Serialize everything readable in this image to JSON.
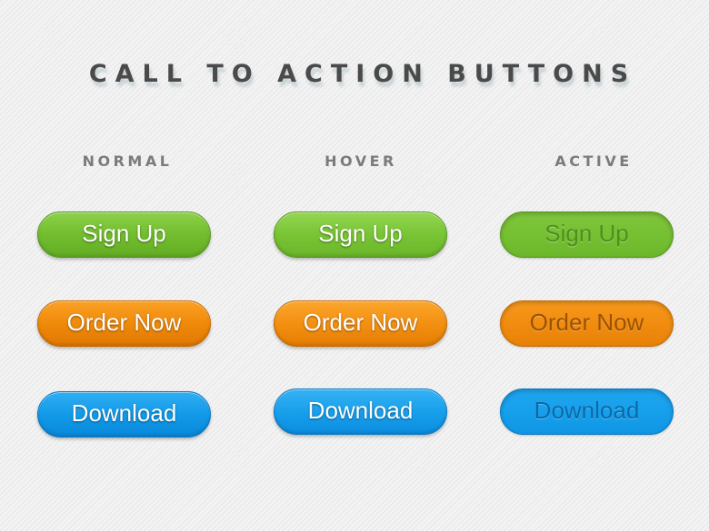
{
  "title": "CALL TO ACTION BUTTONS",
  "columns": [
    {
      "label": "NORMAL",
      "state": "normal"
    },
    {
      "label": "HOVER",
      "state": "hover"
    },
    {
      "label": "ACTIVE",
      "state": "active"
    }
  ],
  "rows": [
    {
      "label": "Sign Up",
      "color_name": "green",
      "color": "#74bf30"
    },
    {
      "label": "Order Now",
      "color_name": "orange",
      "color": "#f08a0a"
    },
    {
      "label": "Download",
      "color_name": "blue",
      "color": "#129ae8"
    }
  ],
  "buttons": {
    "signup_normal": "Sign Up",
    "signup_hover": "Sign Up",
    "signup_active": "Sign Up",
    "order_normal": "Order Now",
    "order_hover": "Order Now",
    "order_active": "Order Now",
    "download_normal": "Download",
    "download_hover": "Download",
    "download_active": "Download"
  },
  "watermark": {
    "glyph": "&"
  }
}
